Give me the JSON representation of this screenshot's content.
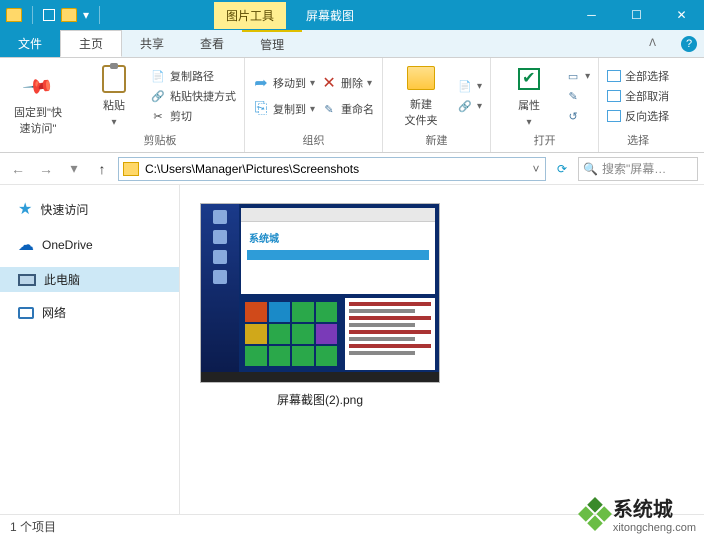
{
  "titlebar": {
    "tool_tab": "图片工具",
    "title": "屏幕截图"
  },
  "tabs": {
    "file": "文件",
    "home": "主页",
    "share": "共享",
    "view": "查看",
    "manage": "管理"
  },
  "ribbon": {
    "pin": {
      "line1": "固定到\"快",
      "line2": "速访问\""
    },
    "paste": "粘贴",
    "copy_path": "复制路径",
    "paste_shortcut": "粘贴快捷方式",
    "cut": "剪切",
    "clipboard_grp": "剪贴板",
    "move_to": "移动到",
    "copy_to": "复制到",
    "delete": "删除",
    "rename": "重命名",
    "organize_grp": "组织",
    "new_folder": {
      "line1": "新建",
      "line2": "文件夹"
    },
    "new_grp": "新建",
    "properties": "属性",
    "open_grp": "打开",
    "select_all": "全部选择",
    "select_none": "全部取消",
    "invert_selection": "反向选择",
    "select_grp": "选择"
  },
  "address": {
    "path": "C:\\Users\\Manager\\Pictures\\Screenshots"
  },
  "search": {
    "placeholder": "搜索\"屏幕…"
  },
  "sidebar": {
    "quick_access": "快速访问",
    "onedrive": "OneDrive",
    "this_pc": "此电脑",
    "network": "网络"
  },
  "content": {
    "file_label": "屏幕截图(2).png",
    "thumb_logo": "系统城"
  },
  "status": {
    "count": "1 个项目"
  },
  "watermark": {
    "brand": "系统城",
    "url": "xitongcheng.com"
  }
}
